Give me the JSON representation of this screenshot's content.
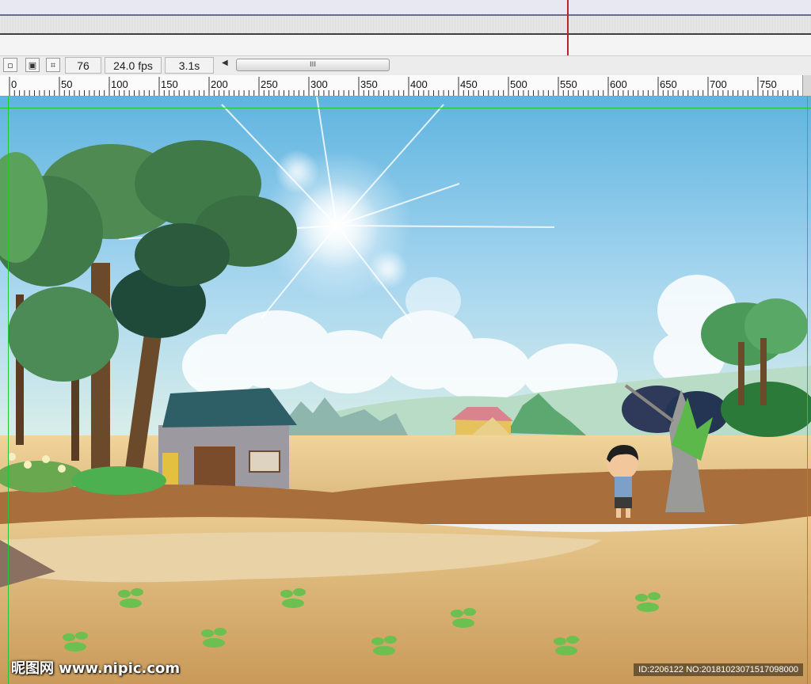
{
  "timeline": {
    "frame_number": "76",
    "frame_rate": "24.0 fps",
    "elapsed_time": "3.1s",
    "scroll_grip": "III"
  },
  "toolbar_icons": [
    "center-frame-icon",
    "onion-skin-icon",
    "edit-multiple-frames-icon"
  ],
  "ruler": {
    "labels": [
      "0",
      "50",
      "100",
      "150",
      "200",
      "250",
      "300",
      "350",
      "400",
      "450",
      "500",
      "550",
      "600",
      "650",
      "700",
      "750"
    ]
  },
  "colors": {
    "playhead": "#c0202a",
    "guides": "#21c832",
    "sky_top": "#5fb4e0",
    "field": "#d9b57a"
  },
  "stage": {
    "watermark_left": "昵图网 www.nipic.com",
    "watermark_right": "ID:2206122 NO:20181023071517098000"
  }
}
